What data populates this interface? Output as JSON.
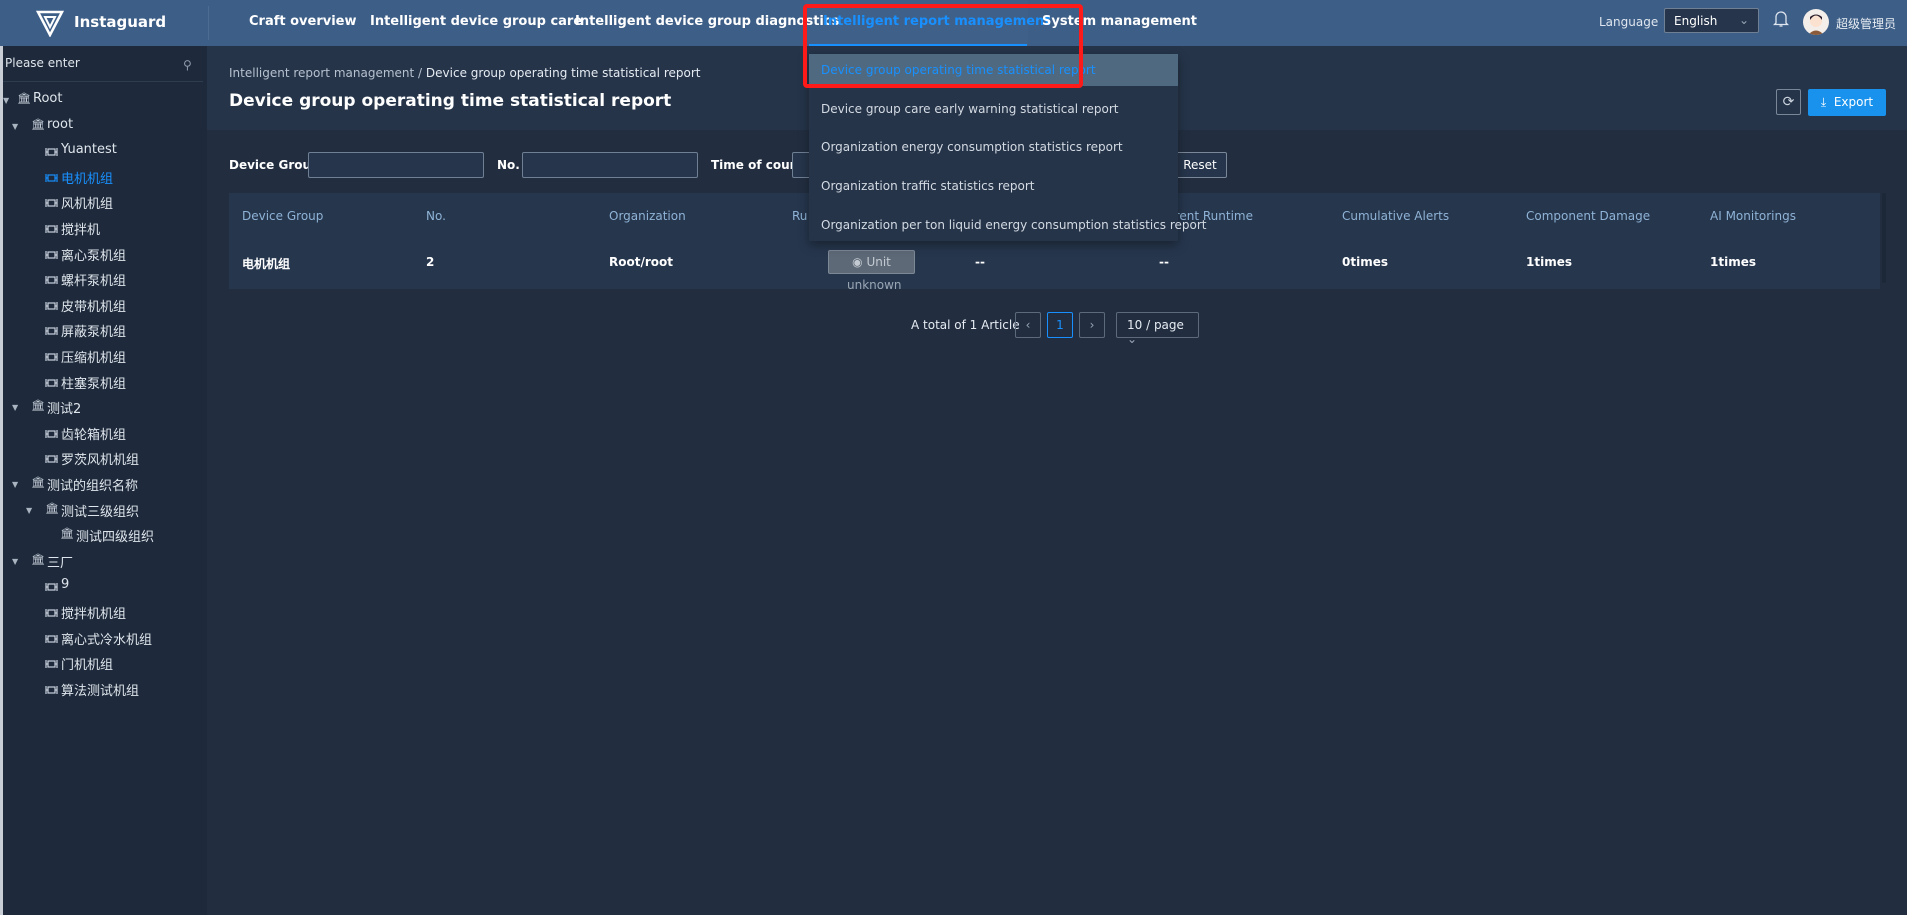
{
  "app": {
    "name": "Instaguard"
  },
  "nav": {
    "items": [
      "Craft overview",
      "Intelligent device group care",
      "Intelligent device group diagnostics",
      "Intelligent report management",
      "System management"
    ],
    "active": "Intelligent report management"
  },
  "header": {
    "language_label": "Language",
    "language_value": "English",
    "username": "超级管理员"
  },
  "sidebar": {
    "search_placeholder": "Please enter",
    "tree": [
      {
        "label": "Root",
        "type": "org"
      },
      {
        "label": "root",
        "type": "org"
      },
      {
        "label": "Yuantest",
        "type": "device"
      },
      {
        "label": "电机机组",
        "type": "device",
        "selected": true
      },
      {
        "label": "风机机组",
        "type": "device"
      },
      {
        "label": "搅拌机",
        "type": "device"
      },
      {
        "label": "离心泵机组",
        "type": "device"
      },
      {
        "label": "螺杆泵机组",
        "type": "device"
      },
      {
        "label": "皮带机机组",
        "type": "device"
      },
      {
        "label": "屏蔽泵机组",
        "type": "device"
      },
      {
        "label": "压缩机机组",
        "type": "device"
      },
      {
        "label": "柱塞泵机组",
        "type": "device"
      },
      {
        "label": "测试2",
        "type": "org"
      },
      {
        "label": "齿轮箱机组",
        "type": "device"
      },
      {
        "label": "罗茨风机机组",
        "type": "device"
      },
      {
        "label": "测试的组织名称",
        "type": "org"
      },
      {
        "label": "测试三级组织",
        "type": "org"
      },
      {
        "label": "测试四级组织",
        "type": "org"
      },
      {
        "label": "三厂",
        "type": "org"
      },
      {
        "label": "9",
        "type": "device"
      },
      {
        "label": "搅拌机机组",
        "type": "device"
      },
      {
        "label": "离心式冷水机组",
        "type": "device"
      },
      {
        "label": "门机机组",
        "type": "device"
      },
      {
        "label": "算法测试机组",
        "type": "device"
      }
    ]
  },
  "breadcrumb": {
    "parent": "Intelligent report management",
    "separator": "/",
    "current": "Device group operating time statistical report"
  },
  "page": {
    "title": "Device group operating time statistical report",
    "export_label": "Export"
  },
  "filters": {
    "device_group_label": "Device Group",
    "device_group_value": "",
    "no_label": "No.",
    "no_value": "",
    "time_label": "Time of count",
    "reset_label": "Reset"
  },
  "table": {
    "headers": [
      "Device Group",
      "No.",
      "Organization",
      "Ru",
      "",
      "Current Runtime",
      "Cumulative Alerts",
      "Component Damage",
      "AI Monitorings"
    ],
    "rows": [
      {
        "device_group": "电机机组",
        "no": "2",
        "organization": "Root/root",
        "unit_button": "Unit",
        "unit_sub": "unknown",
        "c5": "--",
        "current_runtime": "--",
        "alerts": "0times",
        "damage": "1times",
        "ai": "1times"
      }
    ]
  },
  "pagination": {
    "total": "A total of 1 Article",
    "page": "1",
    "page_size": "10 / page"
  },
  "dropdown": {
    "items": [
      "Device group operating time statistical report",
      "Device group care early warning statistical report",
      "Organization energy consumption statistics report",
      "Organization traffic statistics report",
      "Organization per ton liquid energy consumption statistics report"
    ],
    "active_index": 0
  },
  "colors": {
    "header": "#3d5e87",
    "accent": "#1890ff",
    "highlight_box": "#ff1a1a",
    "sidebar": "#1e2a3b"
  }
}
